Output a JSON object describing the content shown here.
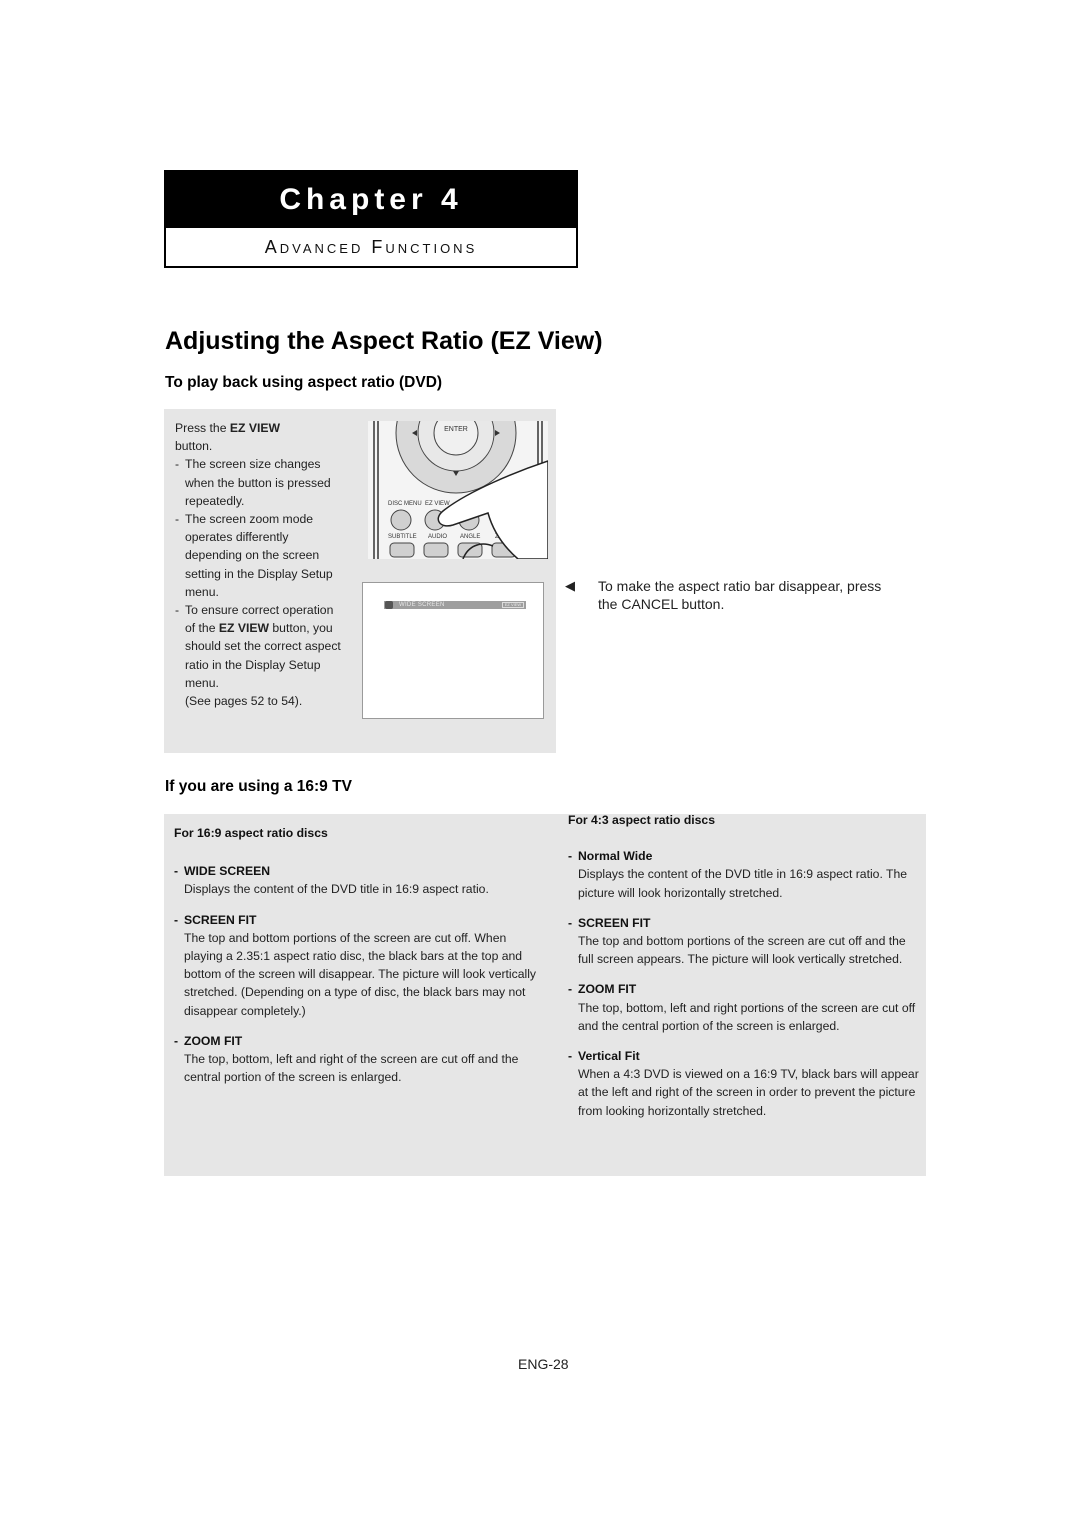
{
  "chapter": {
    "label": "Chapter 4",
    "subtitle": "Advanced Functions"
  },
  "page_title": "Adjusting the Aspect Ratio (EZ View)",
  "section_dvd": {
    "title": "To play back using aspect ratio (DVD)",
    "instruction_prefix": "Press the ",
    "instruction_button": "EZ VIEW",
    "instruction_suffix": "button.",
    "bullets": [
      "The screen size changes when the button is pressed repeatedly.",
      "The screen zoom mode operates differently depending on the screen setting in the Display Setup menu."
    ],
    "bullet3_prefix": "To ensure correct operation of the ",
    "bullet3_bold": "EZ VIEW",
    "bullet3_suffix": " button, you should set the correct aspect ratio in the Display Setup menu.",
    "see_pages": "(See pages 52 to 54).",
    "remote_labels": {
      "enter": "ENTER",
      "disc_menu": "DISC MENU",
      "ez_view": "EZ VIEW",
      "subtitle": "SUBTITLE",
      "audio": "AUDIO",
      "angle": "ANGLE",
      "zoom": "ZOOM"
    },
    "osd": {
      "mode_label": "WIDE SCREEN",
      "badge": "EZ VIEW"
    },
    "note": "To make the aspect ratio bar disappear, press the CANCEL button."
  },
  "section_169": {
    "title": "If you are using a 16:9 TV",
    "left": {
      "heading": "For 16:9 aspect ratio discs",
      "items": [
        {
          "title": "WIDE SCREEN",
          "desc": "Displays the content of the DVD title in 16:9 aspect ratio."
        },
        {
          "title": "SCREEN FIT",
          "desc": "The top and bottom portions of the screen are cut off. When playing a 2.35:1 aspect ratio disc, the black bars at the top and bottom of the screen will disappear. The picture will look vertically stretched. (Depending on a type of disc, the black bars may not disappear completely.)"
        },
        {
          "title": "ZOOM FIT",
          "desc": "The top, bottom, left and right of the screen are cut off and the central portion of the screen is enlarged."
        }
      ]
    },
    "right": {
      "heading": "For 4:3 aspect ratio discs",
      "items": [
        {
          "title": "Normal Wide",
          "desc": "Displays the content of the DVD title in 16:9 aspect ratio. The picture will look horizontally stretched."
        },
        {
          "title": "SCREEN FIT",
          "desc": "The top and bottom portions of the screen are cut off and the full screen appears. The picture will look vertically stretched."
        },
        {
          "title": "ZOOM FIT",
          "desc": "The top, bottom, left and right portions of the screen are cut off and the central portion of the screen is enlarged."
        },
        {
          "title": "Vertical Fit",
          "desc": "When a 4:3 DVD is viewed on a 16:9 TV, black bars will appear at the left and right of the screen in order to prevent the picture from looking horizontally stretched."
        }
      ]
    }
  },
  "page_number": "ENG-28"
}
